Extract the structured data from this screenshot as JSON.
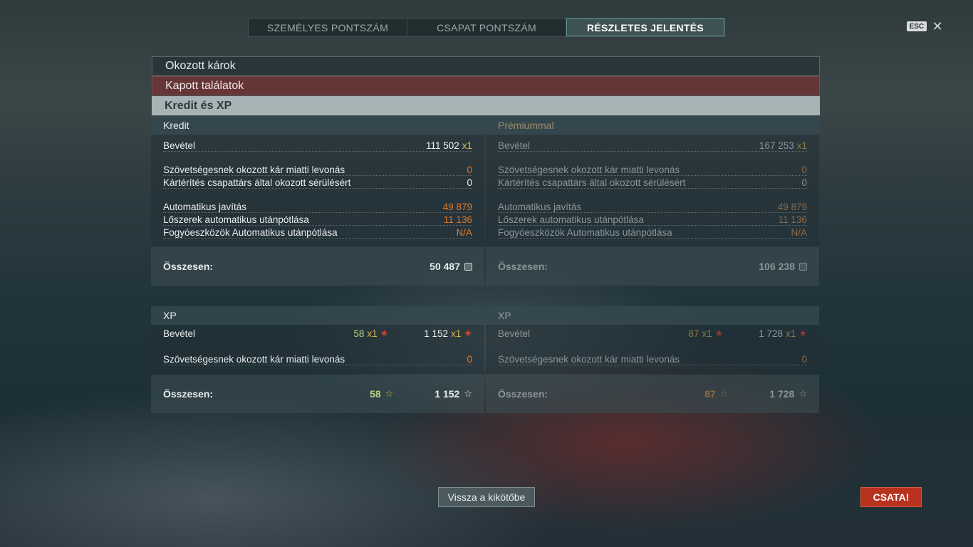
{
  "tabs": [
    {
      "label": "SZEMÉLYES PONTSZÁM"
    },
    {
      "label": "CSAPAT PONTSZÁM"
    },
    {
      "label": "RÉSZLETES JELENTÉS"
    }
  ],
  "esc": {
    "key": "ESC",
    "close": "✕"
  },
  "sections": {
    "damage_caused": "Okozott károk",
    "hits_received": "Kapott találatok",
    "credits_xp": "Kredit és XP"
  },
  "credit": {
    "header": "Kredit",
    "income_label": "Bevétel",
    "income_value": "111 502",
    "income_mult": "x1",
    "ally_damage_label": "Szövetségesnek okozott kár miatti levonás",
    "ally_damage_value": "0",
    "compensation_label": "Kártérítés csapattárs által okozott sérülésért",
    "compensation_value": "0",
    "repair_label": "Automatikus javítás",
    "repair_value": "49 879",
    "ammo_label": "Lőszerek automatikus utánpótlása",
    "ammo_value": "11 136",
    "consumables_label": "Fogyóeszközök Automatikus utánpótlása",
    "consumables_value": "N/A",
    "total_label": "Összesen:",
    "total_value": "50 487"
  },
  "premium_credit": {
    "header": "Prémiummal",
    "income_label": "Bevétel",
    "income_value": "167 253",
    "income_mult": "x1",
    "ally_damage_label": "Szövetségesnek okozott kár miatti levonás",
    "ally_damage_value": "0",
    "compensation_label": "Kártérítés csapattárs által okozott sérülésért",
    "compensation_value": "0",
    "repair_label": "Automatikus javítás",
    "repair_value": "49 879",
    "ammo_label": "Lőszerek automatikus utánpótlása",
    "ammo_value": "11 136",
    "consumables_label": "Fogyóeszközök Automatikus utánpótlása",
    "consumables_value": "N/A",
    "total_label": "Összesen:",
    "total_value": "106 238"
  },
  "xp": {
    "header": "XP",
    "income_label": "Bevétel",
    "income_value_a": "58",
    "income_mult_a": "x1",
    "income_value_b": "1 152",
    "income_mult_b": "x1",
    "ally_damage_label": "Szövetségesnek okozott kár miatti levonás",
    "ally_damage_value": "0",
    "total_label": "Összesen:",
    "total_value_a": "58",
    "total_value_b": "1 152"
  },
  "premium_xp": {
    "header": "XP",
    "income_label": "Bevétel",
    "income_value_a": "87",
    "income_mult_a": "x1",
    "income_value_b": "1 728",
    "income_mult_b": "x1",
    "ally_damage_label": "Szövetségesnek okozott kár miatti levonás",
    "ally_damage_value": "0",
    "total_label": "Összesen:",
    "total_value_a": "87",
    "total_value_b": "1 728"
  },
  "buttons": {
    "back": "Vissza a kikötőbe",
    "battle": "CSATA!"
  },
  "icons": {
    "star": "★",
    "star_outline": "☆",
    "credit_icon": "credit-icon"
  }
}
